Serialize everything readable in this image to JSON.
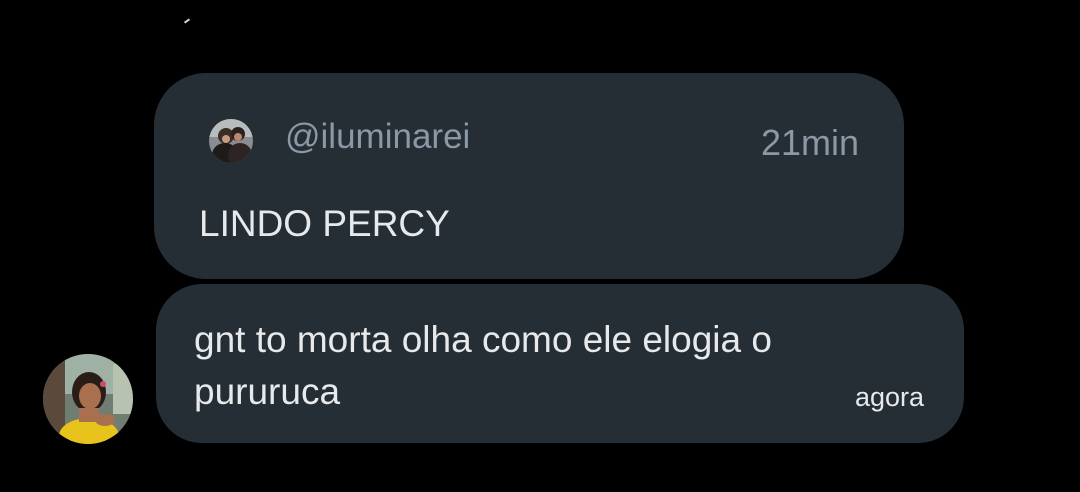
{
  "quoted_message": {
    "handle": "@iluminarei",
    "time": "21min",
    "text": "LINDO PERCY",
    "avatar_icon": "user-avatar-photo"
  },
  "message": {
    "text": "gnt to morta olha como ele elogia o pururuca",
    "time": "agora",
    "avatar_icon": "user-avatar-photo"
  },
  "colors": {
    "background": "#000000",
    "bubble": "#252d35",
    "primary_text": "#e7e9ea",
    "secondary_text": "#8b98a5"
  }
}
